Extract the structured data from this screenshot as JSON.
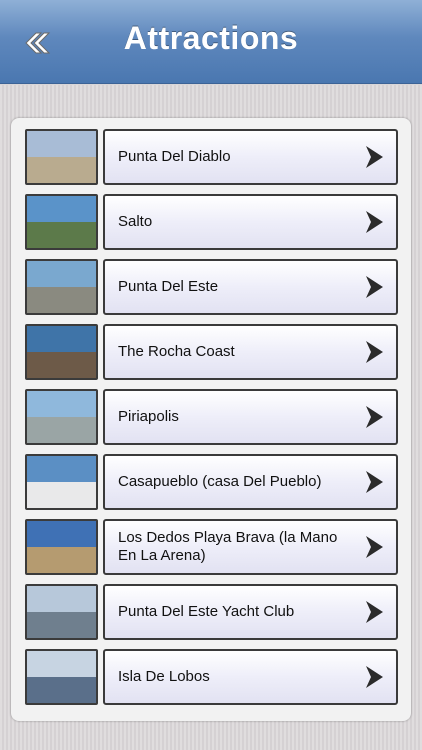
{
  "header": {
    "title": "Attractions",
    "back_icon": "double-chevron-left-icon"
  },
  "attractions": [
    {
      "label": "Punta Del Diablo",
      "sky": "#a8bcd6",
      "ground": "#b9ab8f"
    },
    {
      "label": "Salto",
      "sky": "#5a93c9",
      "ground": "#5c7a4a"
    },
    {
      "label": "Punta Del Este",
      "sky": "#7aa8cf",
      "ground": "#8a8a80"
    },
    {
      "label": "The Rocha Coast",
      "sky": "#3f74a8",
      "ground": "#6d5a48"
    },
    {
      "label": "Piriapolis",
      "sky": "#8fb8dc",
      "ground": "#9aa5a5"
    },
    {
      "label": "Casapueblo (casa Del Pueblo)",
      "sky": "#5b8fc4",
      "ground": "#e9e9ea"
    },
    {
      "label": "Los Dedos Playa Brava (la Mano En La Arena)",
      "sky": "#3f71b5",
      "ground": "#b59b70"
    },
    {
      "label": "Punta Del Este Yacht Club",
      "sky": "#b7c8da",
      "ground": "#6f7f8e"
    },
    {
      "label": "Isla De Lobos",
      "sky": "#c7d4e2",
      "ground": "#5a6f8a"
    }
  ],
  "chevron_icon": "chevron-right-icon"
}
